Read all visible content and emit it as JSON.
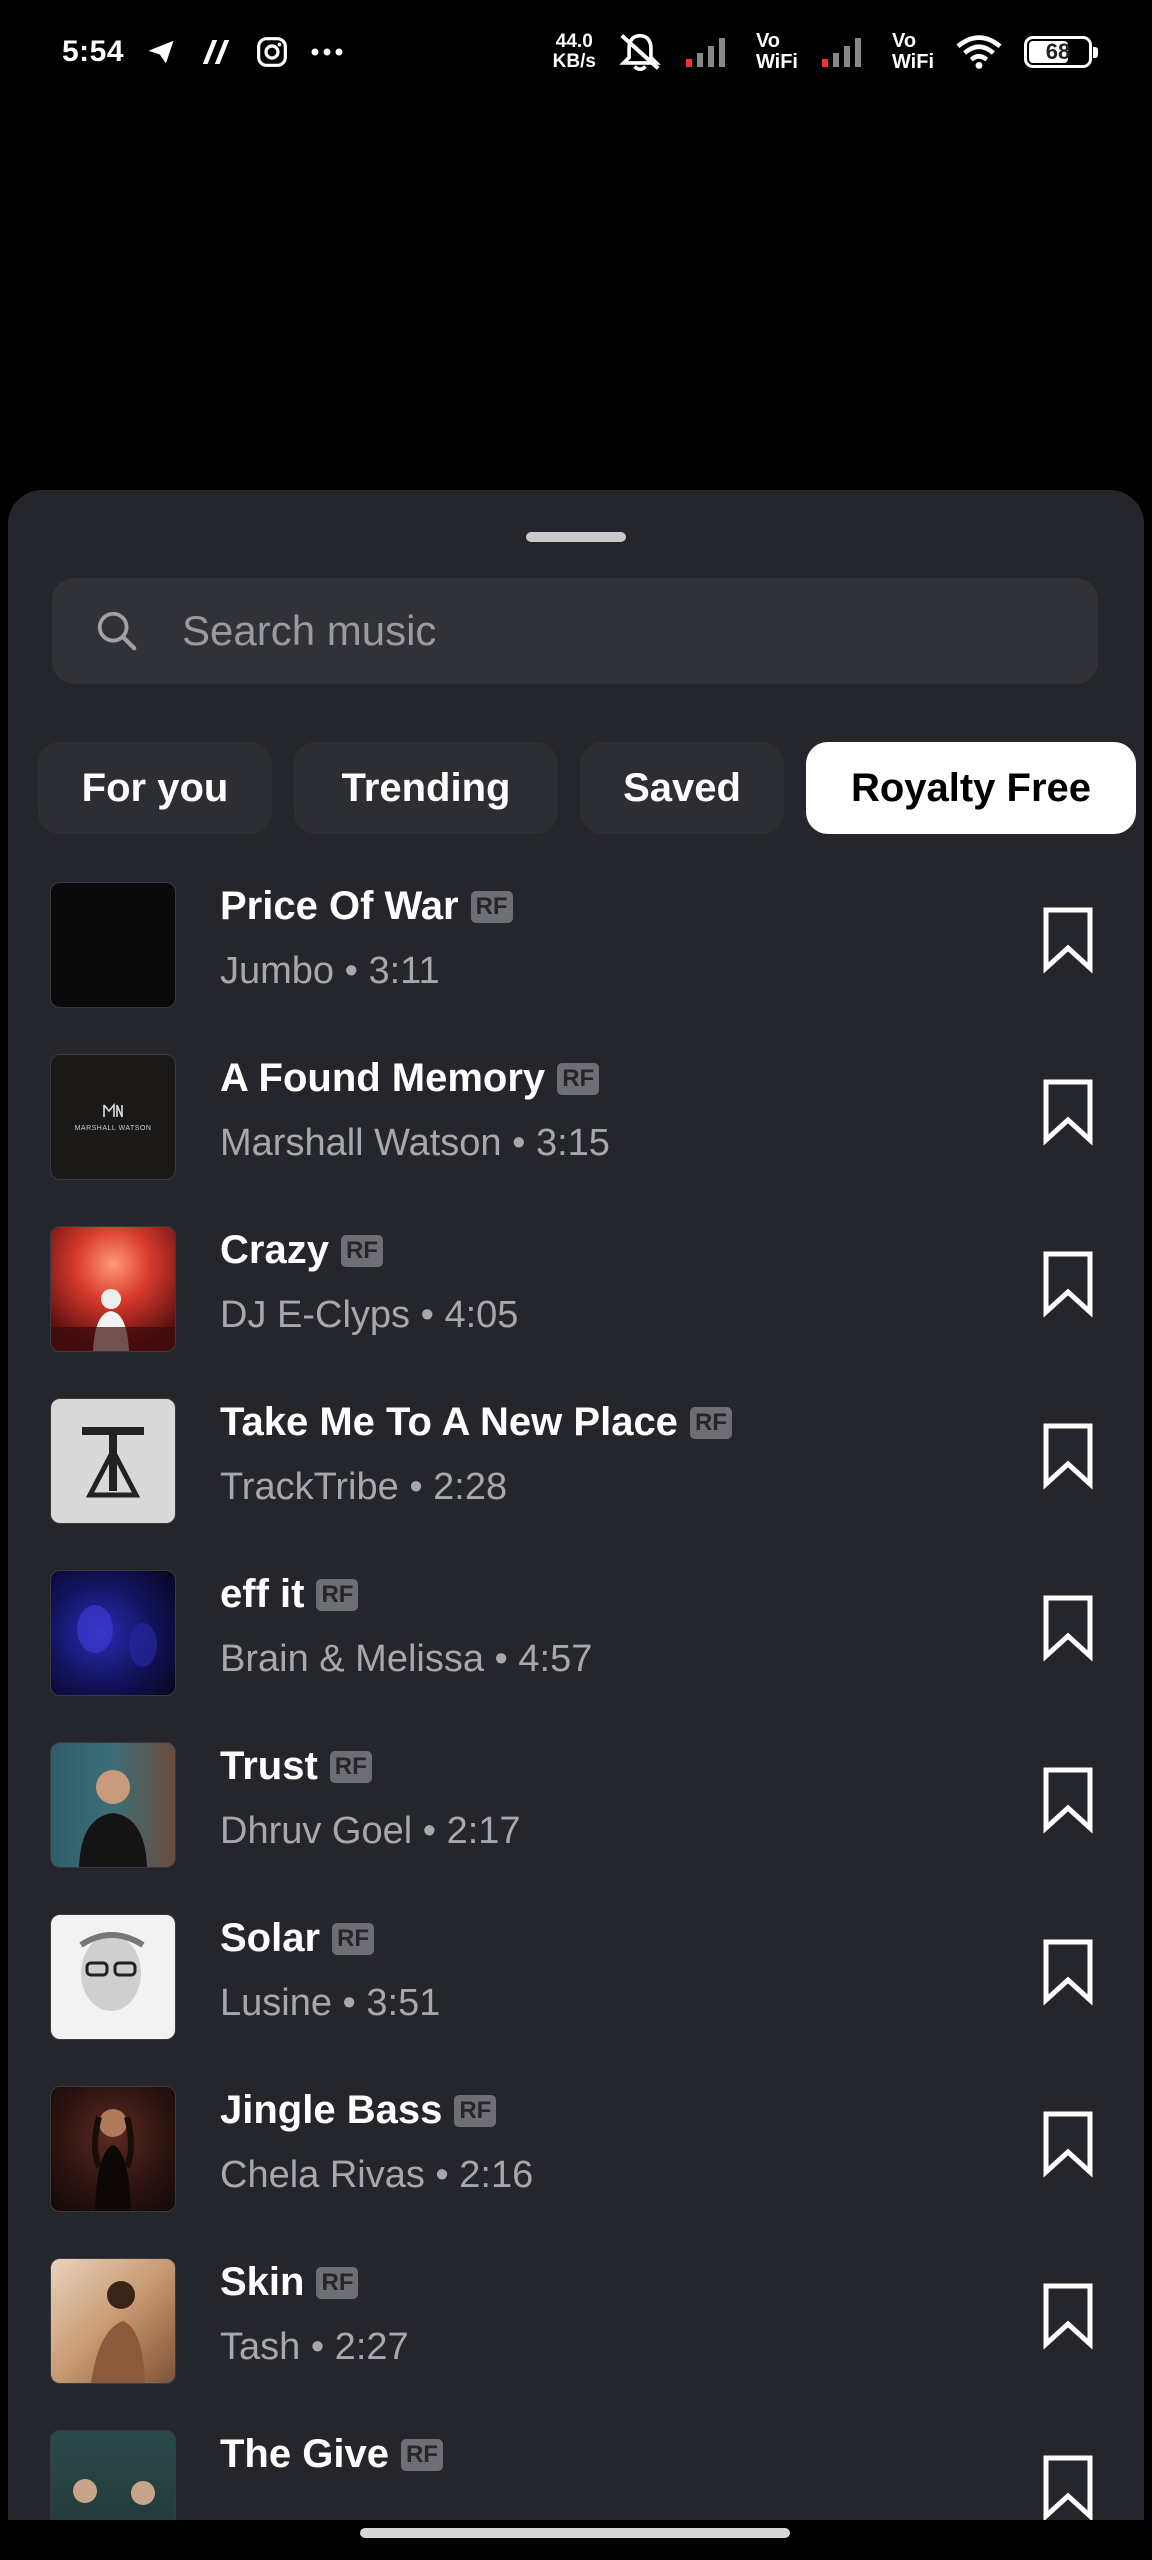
{
  "status_bar": {
    "time": "5:54",
    "speed_value": "44.0",
    "speed_unit": "KB/s",
    "vowifi_1": [
      "Vo",
      "WiFi"
    ],
    "vowifi_2": [
      "Vo",
      "WiFi"
    ],
    "battery": "68",
    "battery_level": 0.68,
    "icons": [
      "telegram-icon",
      "app-icon",
      "instagram-icon",
      "more-dots-icon",
      "mute-icon",
      "signal-icon",
      "wifi-icon",
      "battery-icon"
    ]
  },
  "search": {
    "placeholder": "Search music"
  },
  "tabs": [
    {
      "label": "For you",
      "active": false
    },
    {
      "label": "Trending",
      "active": false
    },
    {
      "label": "Saved",
      "active": false
    },
    {
      "label": "Royalty Free",
      "active": true
    }
  ],
  "badge_label": "RF",
  "tracks": [
    {
      "title": "Price Of War",
      "meta": "Jumbo • 3:11"
    },
    {
      "title": "A Found Memory",
      "meta": "Marshall Watson • 3:15",
      "cover_text": "MARSHALL WATSON"
    },
    {
      "title": "Crazy",
      "meta": "DJ E-Clyps • 4:05"
    },
    {
      "title": "Take Me To A New Place",
      "meta": "TrackTribe • 2:28"
    },
    {
      "title": "eff it",
      "meta": "Brain & Melissa • 4:57"
    },
    {
      "title": "Trust",
      "meta": "Dhruv Goel • 2:17"
    },
    {
      "title": "Solar",
      "meta": "Lusine • 3:51"
    },
    {
      "title": "Jingle Bass",
      "meta": "Chela Rivas • 2:16"
    },
    {
      "title": "Skin",
      "meta": "Tash • 2:27"
    },
    {
      "title": "The Give",
      "meta": ""
    }
  ],
  "colors": {
    "sheet_bg": "#25262b",
    "search_bg": "#313237",
    "tab_bg": "#2d2e33",
    "active_tab_bg": "#ffffff",
    "meta_text": "#a7a8ad"
  }
}
